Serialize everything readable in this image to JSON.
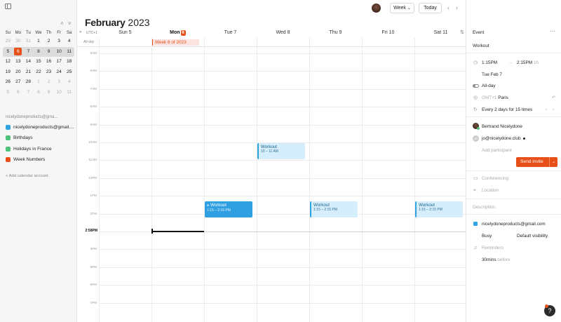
{
  "sidebar": {
    "mini_nav": {
      "prev": "˄",
      "next": "˅"
    },
    "weekdays": [
      "Su",
      "Mo",
      "Tu",
      "We",
      "Th",
      "Fr",
      "Sa"
    ],
    "weeks": [
      [
        "29",
        "30",
        "31",
        "1",
        "2",
        "3",
        "4"
      ],
      [
        "5",
        "6",
        "7",
        "8",
        "9",
        "10",
        "11"
      ],
      [
        "12",
        "13",
        "14",
        "15",
        "16",
        "17",
        "18"
      ],
      [
        "19",
        "20",
        "21",
        "22",
        "23",
        "24",
        "25"
      ],
      [
        "26",
        "27",
        "28",
        "1",
        "2",
        "3",
        "4"
      ],
      [
        "5",
        "6",
        "7",
        "8",
        "9",
        "10",
        "11"
      ]
    ],
    "account": "nicelydoneproducts@gma...",
    "calendars": [
      {
        "label": "nicelydoneproducts@gmail....",
        "color": "#2ea3e3"
      },
      {
        "label": "Birthdays",
        "color": "#4fc27a"
      },
      {
        "label": "Holidays in France",
        "color": "#4fc27a"
      },
      {
        "label": "Week Numbers",
        "color": "#e8501a"
      }
    ],
    "add_calendar": "+ Add calendar account"
  },
  "header": {
    "month": "February",
    "year": "2023",
    "view": "Week",
    "view_caret": "⌄",
    "today": "Today",
    "prev": "‹",
    "next": "›"
  },
  "grid": {
    "timezone": "UTC+1",
    "tz_arrow": "»",
    "sort_icon": "⇅",
    "days": [
      {
        "label": "Sun 5"
      },
      {
        "label": "Mon",
        "badge": "6",
        "today": true
      },
      {
        "label": "Tue 7"
      },
      {
        "label": "Wed 8"
      },
      {
        "label": "Thu 9"
      },
      {
        "label": "Fri 10"
      },
      {
        "label": "Sat 11"
      }
    ],
    "all_day_label": "All-day",
    "week_banner": "Week 6 of 2023",
    "hours": [
      "5AM",
      "6AM",
      "7AM",
      "8AM",
      "9AM",
      "10AM",
      "11AM",
      "12PM",
      "1PM",
      "2PM",
      "3PM",
      "4PM",
      "5PM",
      "6PM",
      "7PM"
    ],
    "now_label": "2:58PM",
    "events": [
      {
        "title": "Workout",
        "time": "10 – 11 AM",
        "day": 3,
        "style": "light",
        "selected": false
      },
      {
        "title": "Workout",
        "time": "1:15 – 2:15 PM",
        "day": 2,
        "style": "solid",
        "selected": true,
        "dot": "●"
      },
      {
        "title": "Workout",
        "time": "1:15 – 2:15 PM",
        "day": 4,
        "style": "light",
        "selected": false
      },
      {
        "title": "Workout",
        "time": "1:15 – 2:15 PM",
        "day": 6,
        "style": "light",
        "selected": false
      }
    ]
  },
  "panel": {
    "header": "Event",
    "more": "···",
    "title": "Workout",
    "start": "1:15PM",
    "arrow": "→",
    "end": "2:15PM",
    "duration": "1h",
    "date": "Tue Feb 7",
    "all_day": "All-day",
    "timezone": "GMT+1",
    "timezone_city": "Paris",
    "recurrence": "Every 2 days for 15 times",
    "organizer": "Bertrand Nicelydone",
    "guest": "jo@nicelydone.club",
    "guest_initials": "JO",
    "add_participant": "Add participant",
    "send_invite": "Send invite",
    "send_caret": "⌄",
    "conferencing": "Conferencing",
    "location": "Location",
    "description": "Description",
    "calendar": "nicelydoneproducts@gmail.com",
    "busy": "Busy",
    "visibility": "Default visibility",
    "reminders": "Reminders",
    "reminder_value": "30mins",
    "reminder_suffix": "before"
  },
  "help": "?",
  "colors": {
    "accent": "#e8501a",
    "event_blue": "#2ea3e3",
    "event_light": "#d6eefb"
  }
}
